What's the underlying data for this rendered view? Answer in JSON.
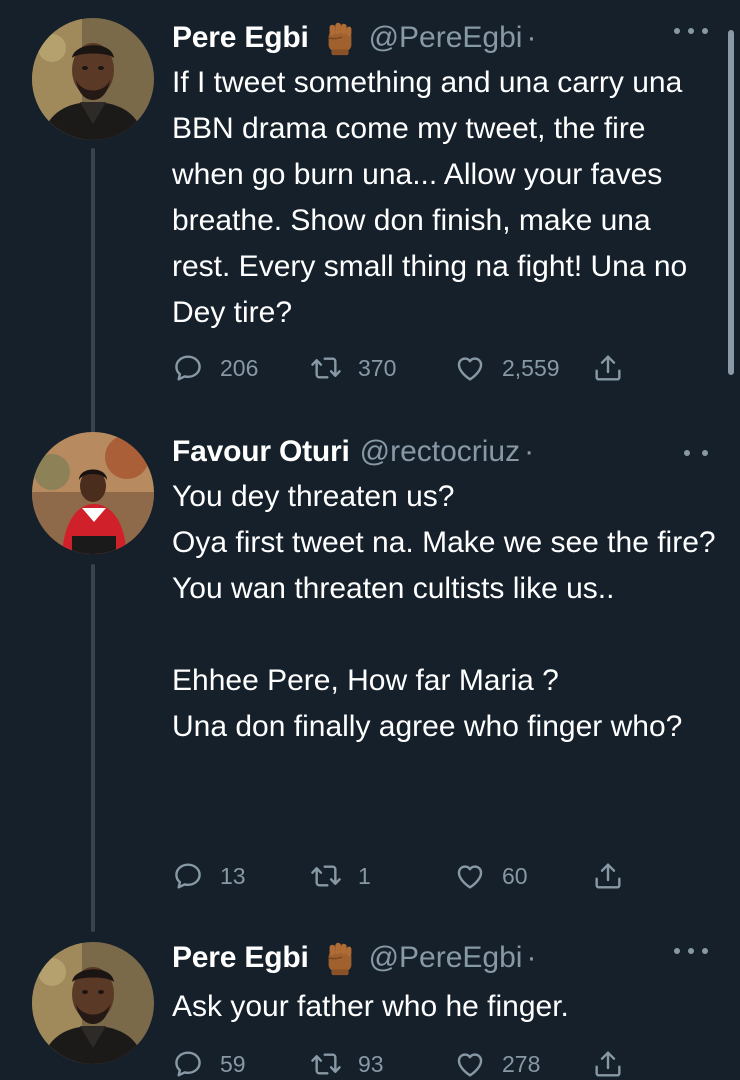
{
  "tweets": [
    {
      "name": "Pere Egbi",
      "emoji": "✊🏾",
      "handle": "@PereEgbi",
      "separator": "·",
      "text": "If I tweet something and una carry una BBN drama come my tweet, the fire when go burn una... Allow your faves breathe. Show don finish, make una rest. Every small thing na fight! Una no Dey tire?",
      "replies": "206",
      "retweets": "370",
      "likes": "2,559"
    },
    {
      "name": "Favour Oturi",
      "handle": "@rectocriuz",
      "separator": "·",
      "text": "You dey threaten us?\nOya first tweet na. Make we see the fire? You wan threaten cultists like us..\n\nEhhee Pere, How far Maria ?\nUna don finally agree who finger who?",
      "replies": "13",
      "retweets": "1",
      "likes": "60"
    },
    {
      "name": "Pere Egbi",
      "emoji": "✊🏾",
      "handle": "@PereEgbi",
      "separator": "·",
      "text": "Ask your father who he finger.",
      "replies": "59",
      "retweets": "93",
      "likes": "278"
    }
  ],
  "icons": {
    "reply": "reply-icon",
    "retweet": "retweet-icon",
    "like": "heart-icon",
    "share": "share-icon",
    "more": "more-icon"
  },
  "colors": {
    "background": "#15202b",
    "secondary_text": "#8899a6",
    "thread_line": "#38444d"
  }
}
